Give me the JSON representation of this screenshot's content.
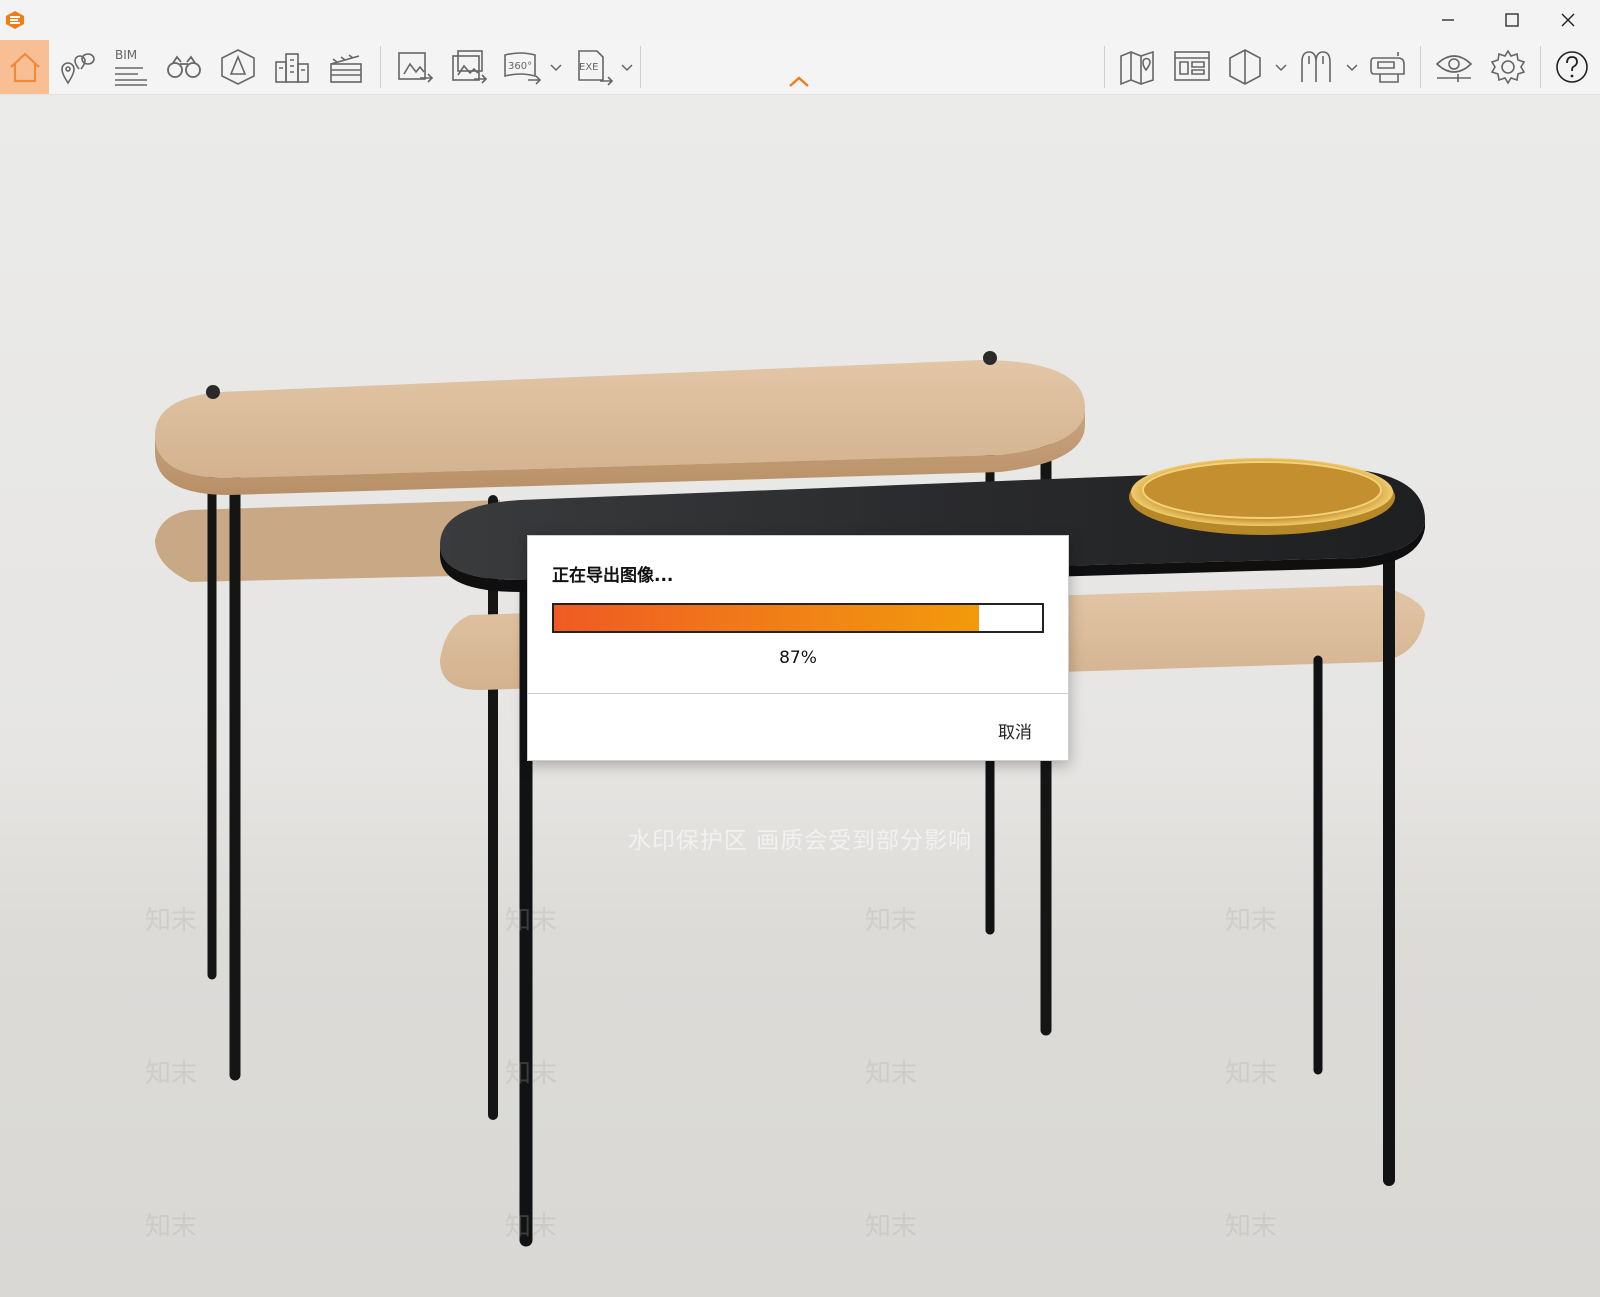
{
  "toolbar": {
    "bim_label": "BIM",
    "pano_label": "360°",
    "exe_label": "EXE",
    "icons": [
      "home-icon",
      "location-pins-icon",
      "bim-icon",
      "binoculars-icon",
      "walkthrough-icon",
      "buildings-icon",
      "clapperboard-icon",
      "export-image-icon",
      "export-batch-images-icon",
      "export-360-panorama-icon",
      "export-exe-icon",
      "map-icon",
      "floorplan-view-icon",
      "section-box-icon",
      "avatars-icon",
      "vr-headset-icon",
      "visibility-icon",
      "settings-icon",
      "help-icon"
    ]
  },
  "window_controls": [
    "minimize-icon",
    "maximize-icon",
    "close-icon"
  ],
  "viewport": {
    "watermark_text": "水印保护区   画质会受到部分影响",
    "watermark_mark": "知末"
  },
  "dialog": {
    "title": "正在导出图像...",
    "progress_value": 0.87,
    "progress_text": "87%",
    "cancel_label": "取消"
  },
  "colors": {
    "accent": "#f07d18",
    "home_active": "#f8bf94",
    "progress_start": "#ef5a24",
    "progress_end": "#f29a0c"
  }
}
